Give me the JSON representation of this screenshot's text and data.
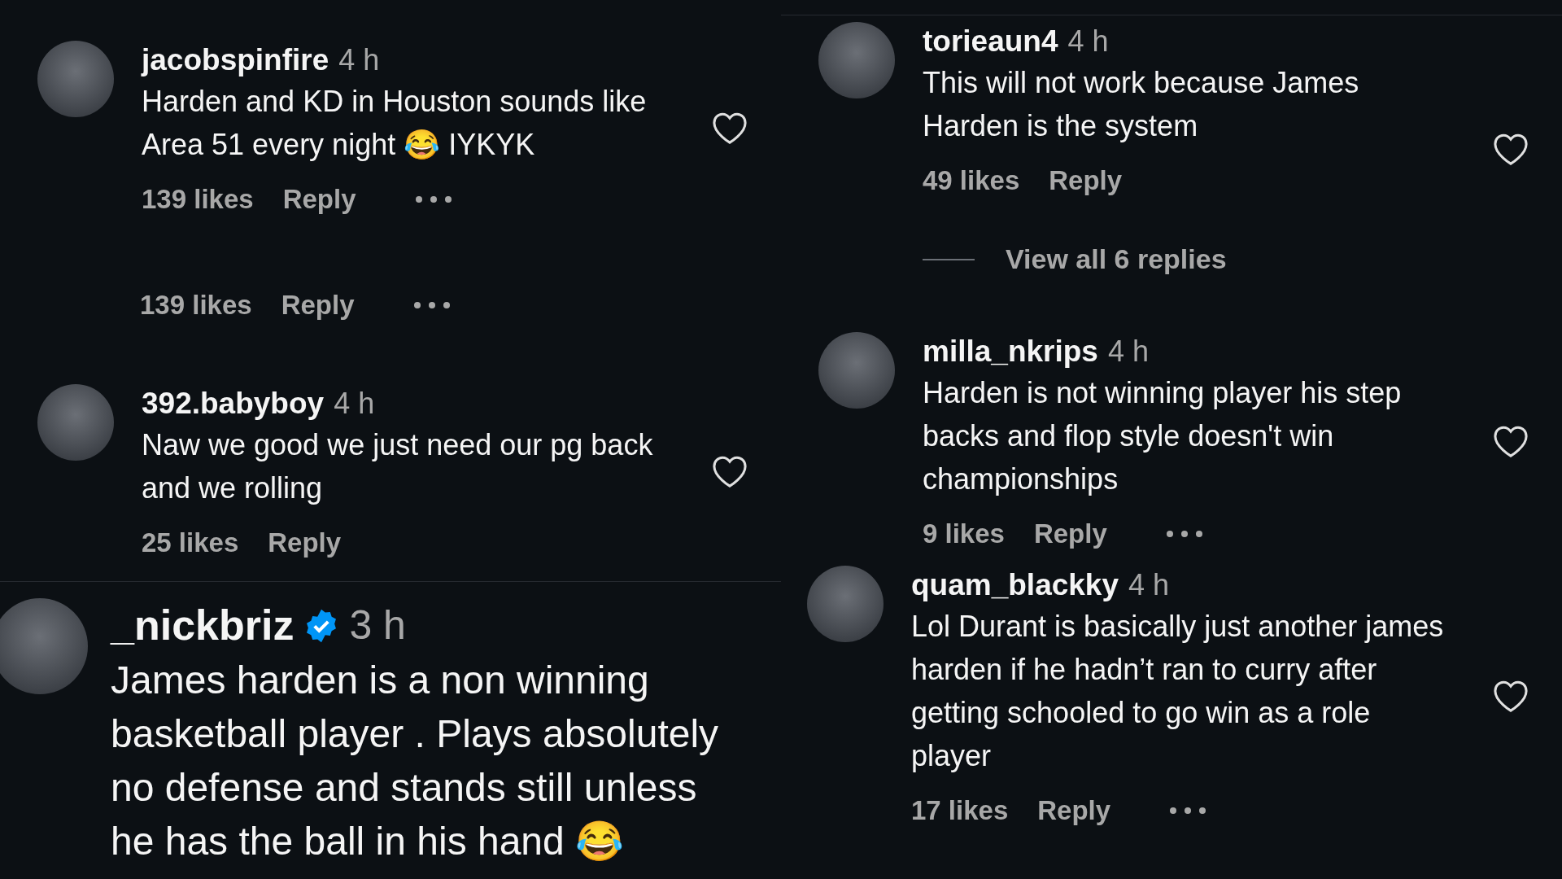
{
  "left_column": [
    {
      "kind": "comment",
      "username": "jacobspinfire",
      "verified": false,
      "time": "4 h",
      "body": "Harden and KD in Houston sounds like Area 51 every night 😂 IYKYK",
      "likes": "139 likes",
      "reply": "Reply",
      "more": true,
      "liked": false
    },
    {
      "kind": "fragment",
      "likes": "139 likes",
      "reply": "Reply",
      "more": true
    },
    {
      "kind": "comment",
      "username": "392.babyboy",
      "verified": false,
      "time": "4 h",
      "body": "Naw we good we just need our pg back and we rolling",
      "likes": "25 likes",
      "reply": "Reply",
      "more": false,
      "liked": false
    },
    {
      "kind": "large",
      "username": "_nickbriz",
      "verified": true,
      "time": "3 h",
      "body": "James harden is a non winning basketball player . Plays absolutely no defense and stands still unless he has the ball in his hand 😂",
      "more": false
    }
  ],
  "right_column": [
    {
      "kind": "comment",
      "username": "torieaun4",
      "verified": false,
      "time": "4 h",
      "body": "This will not work because James Harden is the system",
      "likes": "49 likes",
      "reply": "Reply",
      "more": false,
      "liked": false,
      "replies_link": "View all 6 replies"
    },
    {
      "kind": "comment",
      "username": "milla_nkrips",
      "verified": false,
      "time": "4 h",
      "body": "Harden is not winning player his step backs and flop style doesn't win championships",
      "likes": "9 likes",
      "reply": "Reply",
      "more": true,
      "liked": false
    },
    {
      "kind": "comment",
      "username": "quam_blackky",
      "verified": false,
      "time": "4 h",
      "body": "Lol Durant is basically just another james harden if he hadn’t ran to curry after getting schooled to go win as a role player",
      "likes": "17 likes",
      "reply": "Reply",
      "more": true,
      "liked": false
    }
  ]
}
